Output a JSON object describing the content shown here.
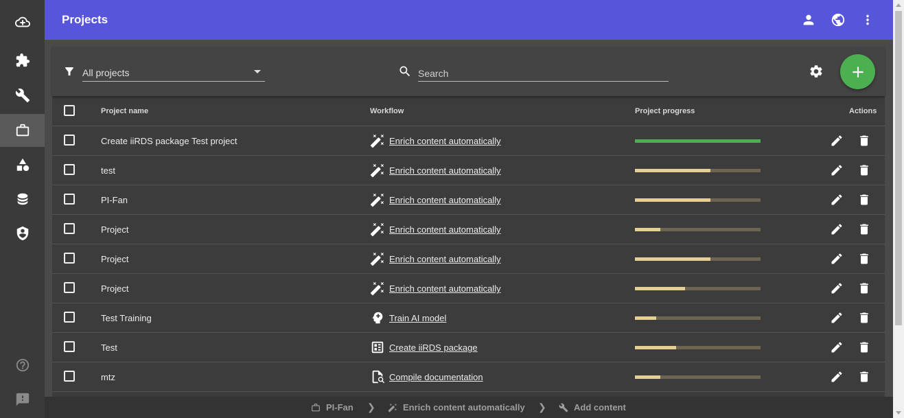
{
  "header": {
    "title": "Projects"
  },
  "sidebar": {
    "items": [
      {
        "icon": "cloud-upload-icon"
      },
      {
        "icon": "puzzle-icon"
      },
      {
        "icon": "wrench-icon"
      },
      {
        "icon": "briefcase-icon",
        "active": true
      },
      {
        "icon": "shapes-icon"
      },
      {
        "icon": "database-icon"
      },
      {
        "icon": "shield-user-icon"
      },
      {
        "icon": "help-icon"
      },
      {
        "icon": "feedback-icon"
      }
    ]
  },
  "toolbar": {
    "filter_value": "All projects",
    "search_placeholder": "Search"
  },
  "table": {
    "columns": [
      "Project name",
      "Workflow",
      "Project progress",
      "Actions"
    ],
    "rows": [
      {
        "name": "Create iiRDS package Test project",
        "workflow": "Enrich content automatically",
        "workflow_icon": "magic-wand-icon",
        "progress": 1.0,
        "complete": true
      },
      {
        "name": "test",
        "workflow": "Enrich content automatically",
        "workflow_icon": "magic-wand-icon",
        "progress": 0.6
      },
      {
        "name": "PI-Fan",
        "workflow": "Enrich content automatically",
        "workflow_icon": "magic-wand-icon",
        "progress": 0.6
      },
      {
        "name": "Project",
        "workflow": "Enrich content automatically",
        "workflow_icon": "magic-wand-icon",
        "progress": 0.2
      },
      {
        "name": "Project",
        "workflow": "Enrich content automatically",
        "workflow_icon": "magic-wand-icon",
        "progress": 0.6
      },
      {
        "name": "Project",
        "workflow": "Enrich content automatically",
        "workflow_icon": "magic-wand-icon",
        "progress": 0.4
      },
      {
        "name": "Test Training",
        "workflow": "Train AI model",
        "workflow_icon": "brain-icon",
        "progress": 0.17
      },
      {
        "name": "Test",
        "workflow": "Create iiRDS package",
        "workflow_icon": "package-icon",
        "progress": 0.33
      },
      {
        "name": "mtz",
        "workflow": "Compile documentation",
        "workflow_icon": "document-search-icon",
        "progress": 0.2
      }
    ]
  },
  "breadcrumb": {
    "items": [
      {
        "label": "PI-Fan",
        "icon": "briefcase-icon"
      },
      {
        "label": "Enrich content automatically",
        "icon": "magic-wand-icon"
      },
      {
        "label": "Add content",
        "icon": "wrench-icon"
      }
    ]
  },
  "colors": {
    "header": "#5755d9",
    "accent_green": "#4caf50",
    "progress_fill": "#e6cf94",
    "progress_track": "#6e6452"
  }
}
